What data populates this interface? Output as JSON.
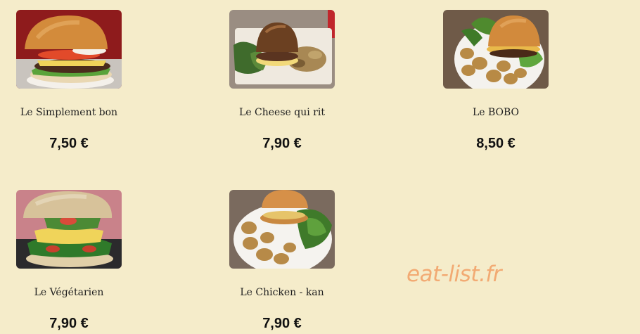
{
  "menu": {
    "items": [
      {
        "name": "Le Simplement bon",
        "price": "7,50 €",
        "photo": "burger-photo"
      },
      {
        "name": "Le Cheese qui rit",
        "price": "7,90 €",
        "photo": "burger-photo"
      },
      {
        "name": "Le BOBO",
        "price": "8,50 €",
        "photo": "burger-photo"
      },
      {
        "name": "Le Végétarien",
        "price": "7,90 €",
        "photo": "burger-photo"
      },
      {
        "name": "Le Chicken - kan",
        "price": "7,90 €",
        "photo": "burger-photo"
      }
    ]
  },
  "watermark": "eat-list.fr",
  "colors": {
    "background": "#f5ecca",
    "watermark": "#f2a36a",
    "text": "#1e1e1e"
  }
}
